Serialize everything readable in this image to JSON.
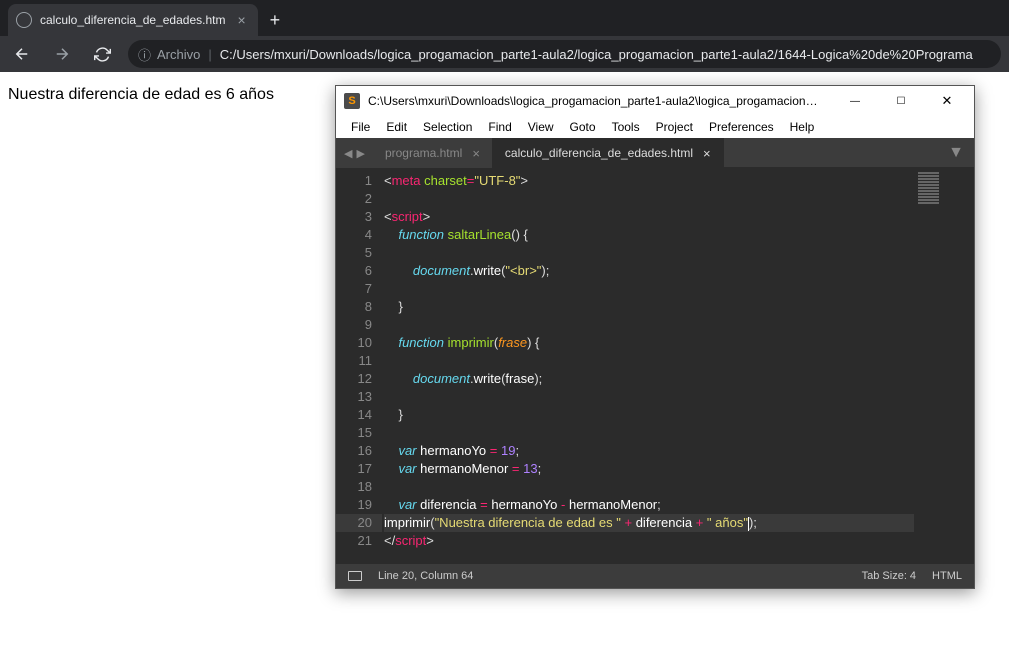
{
  "browser": {
    "tab_title": "calculo_diferencia_de_edades.htm",
    "addr_label": "Archivo",
    "url": "C:/Users/mxuri/Downloads/logica_progamacion_parte1-aula2/logica_progamacion_parte1-aula2/1644-Logica%20de%20Programa"
  },
  "page": {
    "output_text": "Nuestra diferencia de edad es 6 años"
  },
  "sublime": {
    "window_title": "C:\\Users\\mxuri\\Downloads\\logica_progamacion_parte1-aula2\\logica_progamacion_par...",
    "menu": [
      "File",
      "Edit",
      "Selection",
      "Find",
      "View",
      "Goto",
      "Tools",
      "Project",
      "Preferences",
      "Help"
    ],
    "tabs": {
      "inactive": "programa.html",
      "active": "calculo_diferencia_de_edades.html"
    },
    "code": {
      "l1": {
        "tag": "meta",
        "attr": "charset",
        "val": "\"UTF-8\""
      },
      "l3": "script",
      "l4": {
        "kw": "function",
        "name": "saltarLinea"
      },
      "l6": {
        "obj": "document",
        "method": "write",
        "arg": "\"<br>\""
      },
      "l10": {
        "kw": "function",
        "name": "imprimir",
        "param": "frase"
      },
      "l12": {
        "obj": "document",
        "method": "write",
        "arg": "frase"
      },
      "l16": {
        "var": "hermanoYo",
        "val": "19"
      },
      "l17": {
        "var": "hermanoMenor",
        "val": "13"
      },
      "l19": {
        "var": "diferencia",
        "rhs_a": "hermanoYo",
        "rhs_b": "hermanoMenor"
      },
      "l20": {
        "fn": "imprimir",
        "s1": "\"Nuestra diferencia de edad es \"",
        "v": "diferencia",
        "s2": "\" años\""
      },
      "l21": "script"
    },
    "status": {
      "pos": "Line 20, Column 64",
      "tab_size": "Tab Size: 4",
      "lang": "HTML"
    }
  }
}
